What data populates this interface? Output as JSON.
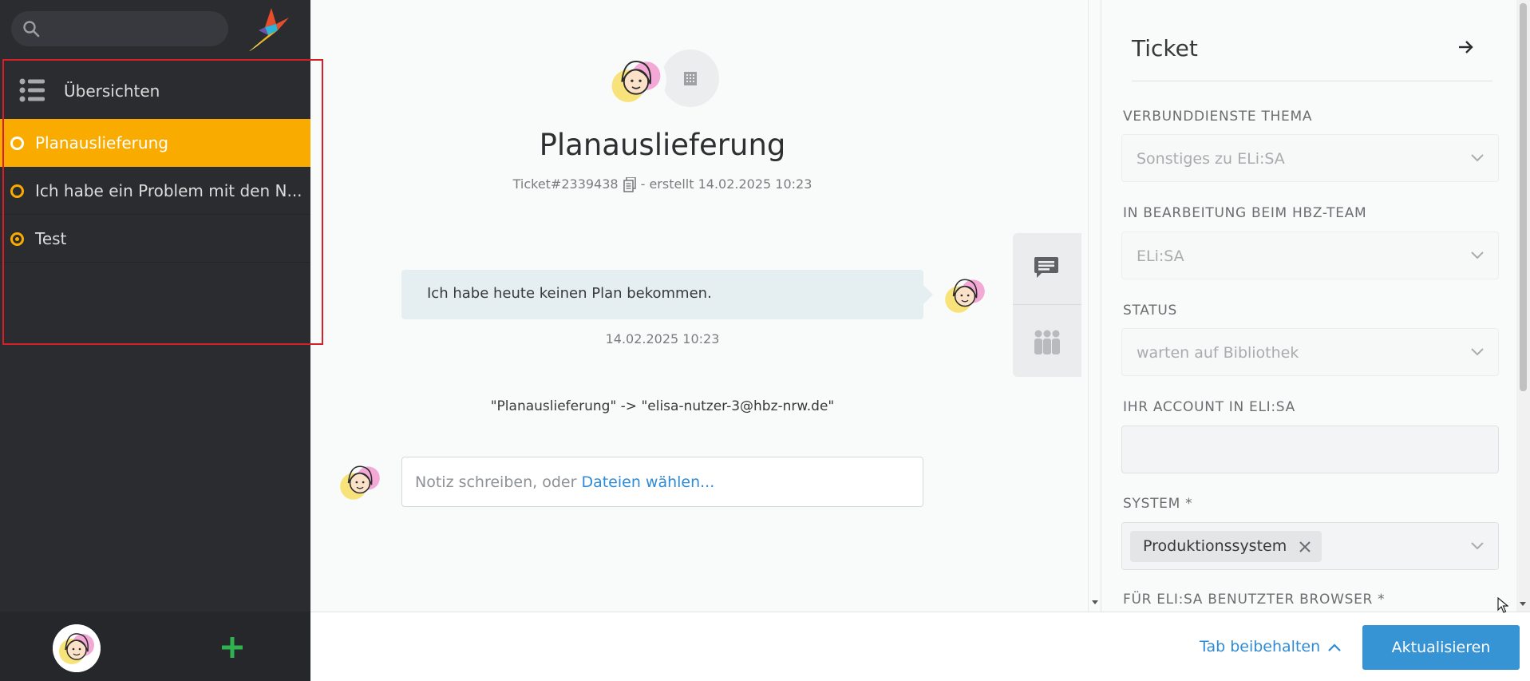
{
  "sidebar": {
    "search": {
      "placeholder": ""
    },
    "overview_label": "Übersichten",
    "tabs": [
      {
        "label": "Planauslieferung",
        "active": true
      },
      {
        "label": "Ich habe ein Problem mit den N...",
        "active": false
      },
      {
        "label": "Test",
        "active": false
      }
    ]
  },
  "ticket": {
    "title": "Planauslieferung",
    "number": "Ticket#2339438",
    "created": "- erstellt 14.02.2025 10:23",
    "message": "Ich habe heute keinen Plan bekommen.",
    "message_time": "14.02.2025 10:23",
    "system_line": "\"Planauslieferung\" -> \"elisa-nutzer-3@hbz-nrw.de\"",
    "note_placeholder": "Notiz schreiben, oder ",
    "note_link": "Dateien wählen..."
  },
  "panel": {
    "title": "Ticket",
    "fields": [
      {
        "label": "Verbunddienste Thema",
        "value": "Sonstiges zu ELi:SA"
      },
      {
        "label": "In Bearbeitung beim hbz-Team",
        "value": "ELi:SA"
      },
      {
        "label": "Status",
        "value": "warten auf Bibliothek"
      },
      {
        "label": "Ihr Account in ELi:SA",
        "value": ""
      },
      {
        "label": "System *",
        "token": "Produktionssystem"
      },
      {
        "label": "Für ELi:SA benutzter Browser *"
      }
    ]
  },
  "bottom": {
    "keep_tab": "Tab beibehalten",
    "update": "Aktualisieren"
  },
  "colors": {
    "accent": "#faab00",
    "primary_button": "#3794d4",
    "link": "#2f8bd6",
    "sidebar_bg": "#2b2c30",
    "add_icon": "#2fb14f",
    "highlight_border": "#d61f26"
  }
}
